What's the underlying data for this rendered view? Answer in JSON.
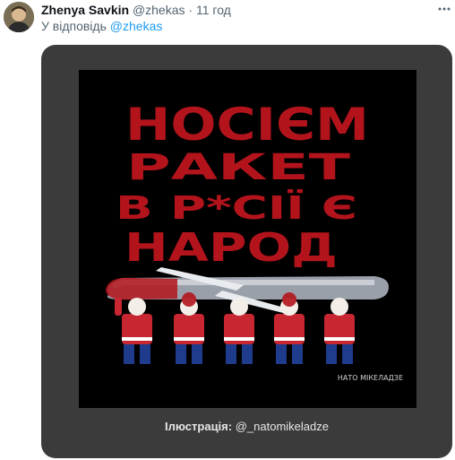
{
  "tweet": {
    "author_name": "Zhenya Savkin",
    "handle": "@zhekas",
    "separator": "·",
    "time": "11 год",
    "reply_prefix": "У відповідь",
    "reply_to": "@zhekas",
    "more_icon": "more-horizontal-icon"
  },
  "card": {
    "artwork": {
      "headline_lines": [
        "НОСІЄМ",
        "РАКЕТ",
        "В Р*СІЇ Є",
        "НАРОД"
      ],
      "signature": "НАТО МІКЕЛАДЗЕ",
      "colors": {
        "background": "#000000",
        "headline": "#b3141c",
        "shirt": "#c82630",
        "trousers": "#1f3b8c"
      }
    },
    "credit_label": "Ілюстрація:",
    "credit_handle": "@_natomikeladze"
  },
  "colors": {
    "card_bg": "#3b3b3b",
    "accent": "#1d9bf0",
    "muted": "#536471"
  }
}
